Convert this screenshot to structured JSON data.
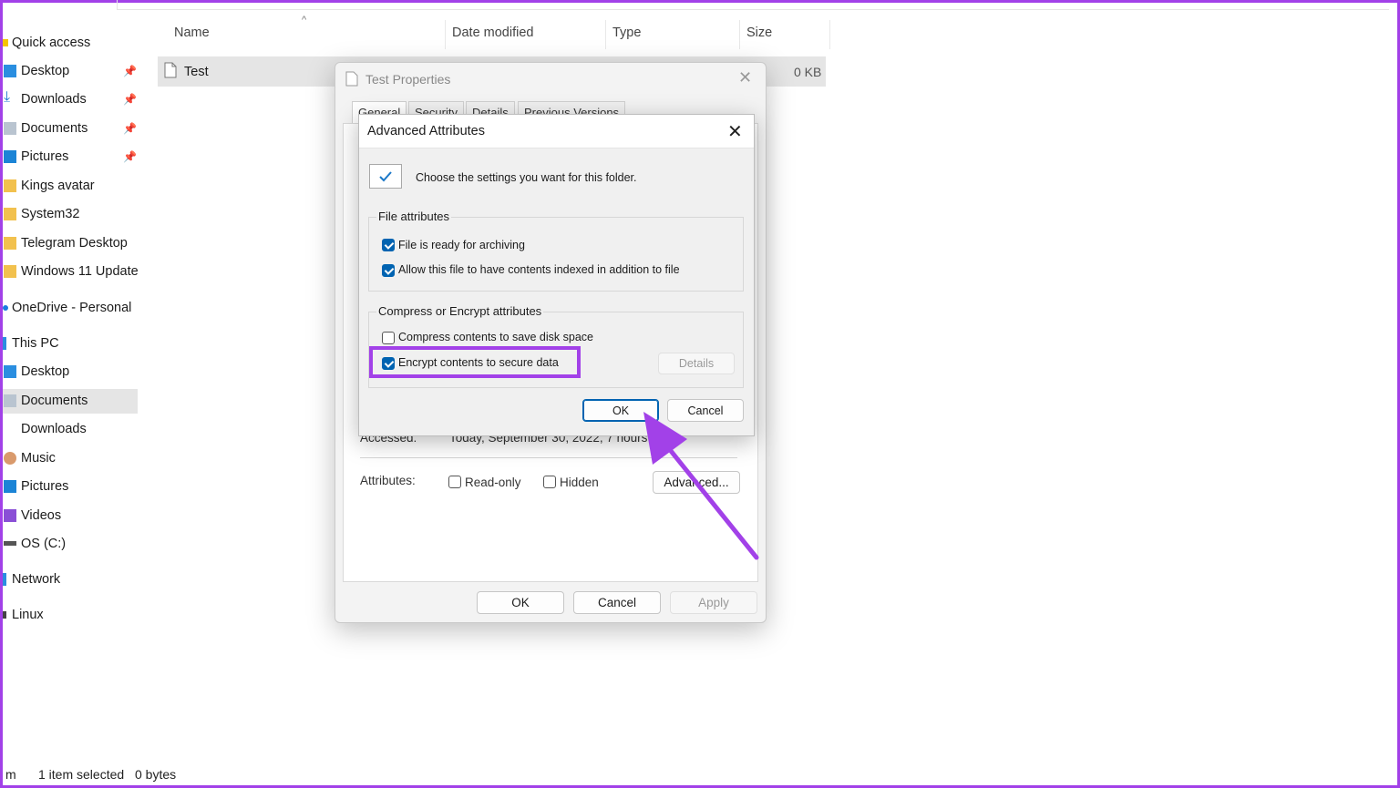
{
  "explorer": {
    "columns": {
      "name": "Name",
      "date_modified": "Date modified",
      "type": "Type",
      "size": "Size"
    },
    "file": {
      "name": "Test",
      "size": "0 KB"
    },
    "sidebar": {
      "quick_access": "Quick access",
      "pinned": [
        {
          "label": "Desktop",
          "icon": "desktop-icon"
        },
        {
          "label": "Downloads",
          "icon": "download-icon"
        },
        {
          "label": "Documents",
          "icon": "documents-icon"
        },
        {
          "label": "Pictures",
          "icon": "pictures-icon"
        }
      ],
      "folders": [
        "Kings avatar",
        "System32",
        "Telegram Desktop",
        "Windows 11 Update"
      ],
      "onedrive": "OneDrive - Personal",
      "this_pc": "This PC",
      "pc_items": [
        "Desktop",
        "Documents",
        "Downloads",
        "Music",
        "Pictures",
        "Videos",
        "OS (C:)"
      ],
      "network": "Network",
      "linux": "Linux"
    },
    "status": {
      "left": "m",
      "selection": "1 item selected",
      "bytes": "0 bytes"
    }
  },
  "properties": {
    "title": "Test Properties",
    "tabs": [
      "General",
      "Security",
      "Details",
      "Previous Versions"
    ],
    "accessed_label": "Accessed:",
    "accessed_value": "Today, September 30, 2022, 7 hours a",
    "attributes_label": "Attributes:",
    "readonly_label": "Read-only",
    "hidden_label": "Hidden",
    "advanced_button": "Advanced...",
    "ok": "OK",
    "cancel": "Cancel",
    "apply": "Apply"
  },
  "advanced": {
    "title": "Advanced Attributes",
    "intro": "Choose the settings you want for this folder.",
    "file_attributes_title": "File attributes",
    "archive_label": "File is ready for archiving",
    "index_label": "Allow this file to have contents indexed in addition to file",
    "compress_encrypt_title": "Compress or Encrypt attributes",
    "compress_label": "Compress contents to save disk space",
    "encrypt_label": "Encrypt contents to secure data",
    "details_button": "Details",
    "ok": "OK",
    "cancel": "Cancel",
    "states": {
      "archive": true,
      "index": true,
      "compress": false,
      "encrypt": true
    }
  },
  "colors": {
    "highlight": "#a241e8",
    "accent": "#0063b1"
  }
}
